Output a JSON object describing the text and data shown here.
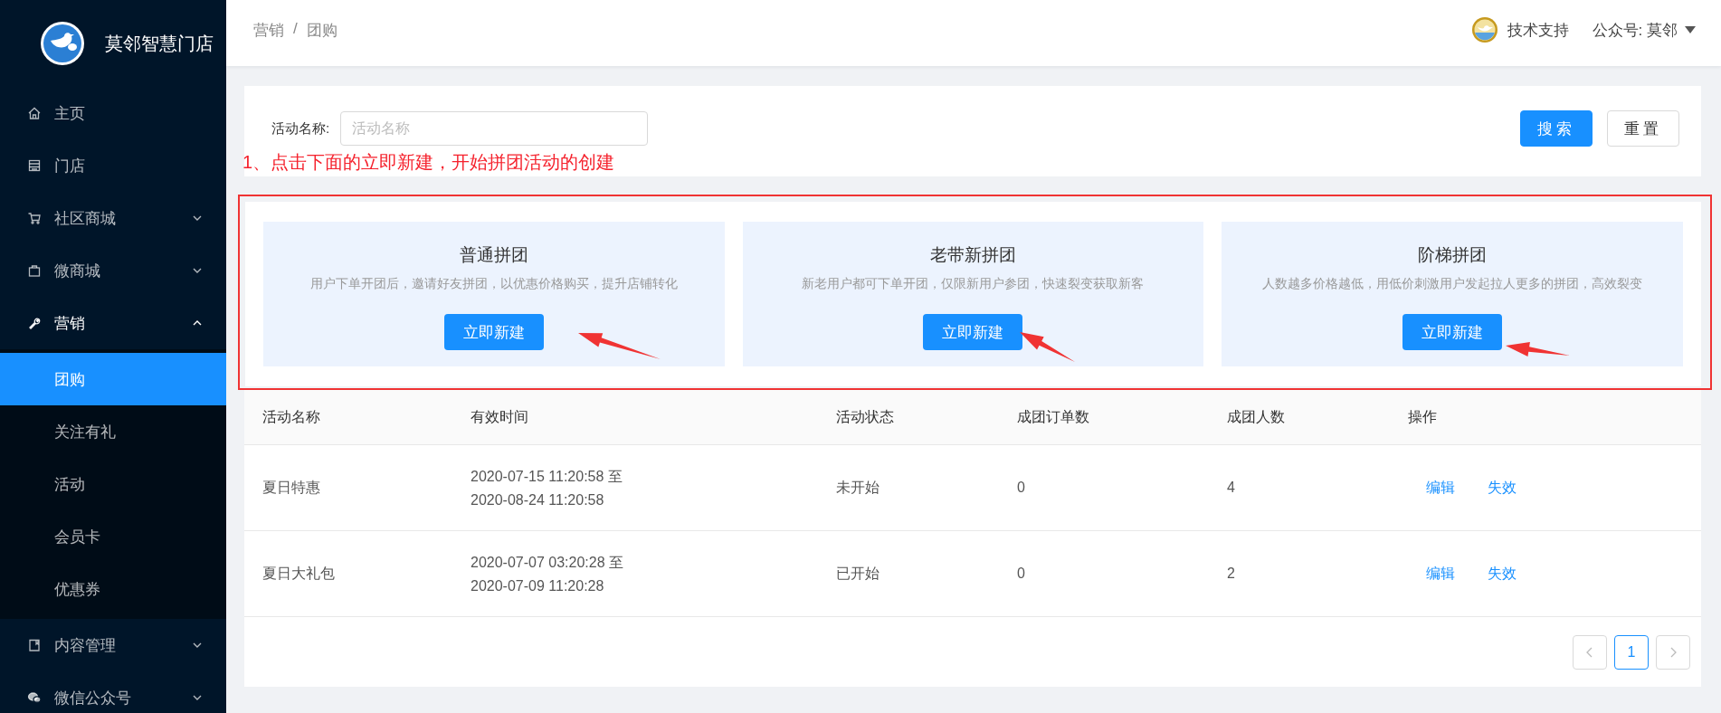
{
  "sidebar": {
    "brand": "莫邻智慧门店",
    "items": [
      {
        "label": "主页",
        "selected": false
      },
      {
        "label": "门店",
        "selected": false
      },
      {
        "label": "社区商城",
        "selected": false,
        "expanded": false
      },
      {
        "label": "微商城",
        "selected": false,
        "expanded": false
      },
      {
        "label": "营销",
        "selected": false,
        "expanded": true,
        "children": [
          {
            "label": "团购",
            "selected": true
          },
          {
            "label": "关注有礼",
            "selected": false
          },
          {
            "label": "活动",
            "selected": false
          },
          {
            "label": "会员卡",
            "selected": false
          },
          {
            "label": "优惠券",
            "selected": false
          }
        ]
      },
      {
        "label": "内容管理",
        "selected": false,
        "expanded": false
      },
      {
        "label": "微信公众号",
        "selected": false,
        "expanded": false
      }
    ]
  },
  "header": {
    "breadcrumb": [
      "营销",
      "团购"
    ],
    "breadcrumb_separator": "/",
    "support": "技术支持",
    "account": "公众号: 莫邻"
  },
  "filter": {
    "label": "活动名称:",
    "placeholder": "活动名称",
    "buttons": [
      {
        "label": "搜索",
        "kind": "primary"
      },
      {
        "label": "重置",
        "kind": "default"
      }
    ]
  },
  "annotation": "1、点击下面的立即新建，开始拼团活动的创建",
  "cards": [
    {
      "title": "普通拼团",
      "description": "用户下单开团后，邀请好友拼团，以优惠价格购买，提升店铺转化",
      "button": "立即新建"
    },
    {
      "title": "老带新拼团",
      "description": "新老用户都可下单开团，仅限新用户参团，快速裂变获取新客",
      "button": "立即新建"
    },
    {
      "title": "阶梯拼团",
      "description": "人数越多价格越低，用低价刺激用户发起拉人更多的拼团，高效裂变",
      "button": "立即新建"
    }
  ],
  "table": {
    "columns": [
      "活动名称",
      "有效时间",
      "活动状态",
      "成团订单数",
      "成团人数",
      "操作"
    ],
    "rows": [
      {
        "name": "夏日特惠",
        "time": [
          "2020-07-15 11:20:58 至",
          "2020-08-24 11:20:58"
        ],
        "status": "未开始",
        "orders": "0",
        "people": "4",
        "actions": [
          "编辑",
          "失效"
        ]
      },
      {
        "name": "夏日大礼包",
        "time": [
          "2020-07-07 03:20:28 至",
          "2020-07-09 11:20:28"
        ],
        "status": "已开始",
        "orders": "0",
        "people": "2",
        "actions": [
          "编辑",
          "失效"
        ]
      }
    ]
  },
  "pagination": {
    "pages": [
      {
        "label": "1",
        "selected": true
      }
    ]
  }
}
